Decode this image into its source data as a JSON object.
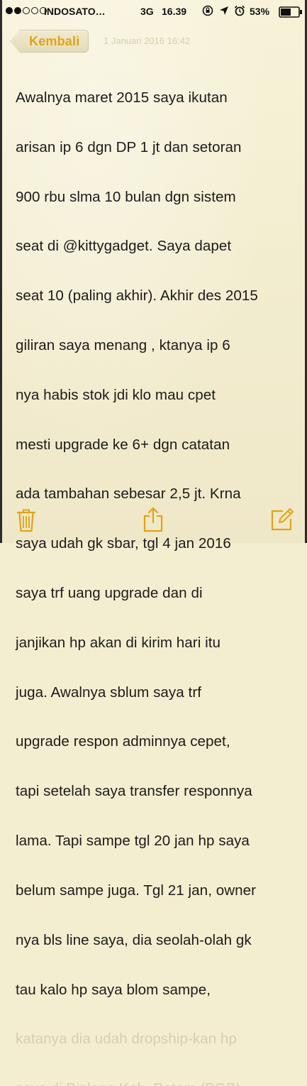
{
  "status_bar": {
    "carrier": "INDOSATO…",
    "network": "3G",
    "time": "16.39",
    "battery": "53%",
    "signal_bars_filled": 2,
    "signal_bars_total": 5
  },
  "nav": {
    "back_label": "Kembali",
    "date_text": "1 Januari 2016 16:42"
  },
  "note": {
    "lines": [
      "Awalnya maret 2015 saya ikutan",
      "arisan ip 6 dgn DP 1 jt dan setoran",
      "900 rbu slma 10 bulan dgn sistem",
      "seat di @kittygadget. Saya dapet",
      "seat 10 (paling akhir). Akhir des 2015",
      "giliran saya menang , ktanya ip 6",
      "nya habis stok jdi klo mau cpet",
      "mesti upgrade ke 6+ dgn catatan",
      "ada tambahan sebesar 2,5 jt. Krna",
      "saya udah gk sbar, tgl 4 jan 2016",
      "saya trf uang upgrade dan di",
      "janjikan hp akan di kirim hari itu",
      "juga. Awalnya sblum saya trf",
      "upgrade respon adminnya cepet,",
      "tapi setelah saya transfer responnya",
      "lama. Tapi sampe tgl 20 jan hp saya",
      "belum sampe juga. Tgl 21 jan, owner",
      "nya bls line saya, dia seolah-olah gk",
      "tau kalo hp saya blom sampe,"
    ],
    "faded_lines": [
      "katanya dia udah dropship-kan hp",
      "saya di Binlang Kab. Batam (BGB)"
    ]
  },
  "toolbar": {
    "trash": "trash-icon",
    "share": "share-icon",
    "compose": "compose-icon"
  },
  "colors": {
    "accent": "#e1a318",
    "paper": "#f4eed0",
    "text": "#1b1b1b",
    "faded_text": "#d6cfae"
  }
}
